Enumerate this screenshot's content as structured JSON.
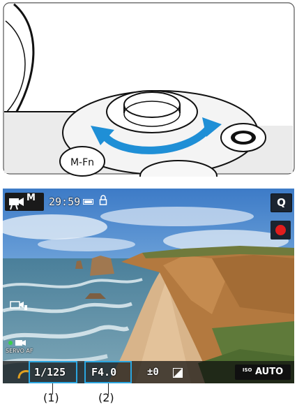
{
  "camera_screen": {
    "shooting_mode": "M",
    "recording_time": "29:59",
    "quick_button": "Q",
    "af_label": "SERVO AF",
    "shutter_speed": "1/125",
    "aperture": "F4.0",
    "exposure_compensation": "±0",
    "iso_label": "ISO",
    "iso_value": "AUTO",
    "record_color": "#e21d1d",
    "highlight_color": "#2aa6e0"
  },
  "dial_illustration": {
    "button_label": "M-Fn",
    "arrow_color": "#1f8fd6"
  },
  "callouts": [
    "(1)",
    "(2)"
  ]
}
